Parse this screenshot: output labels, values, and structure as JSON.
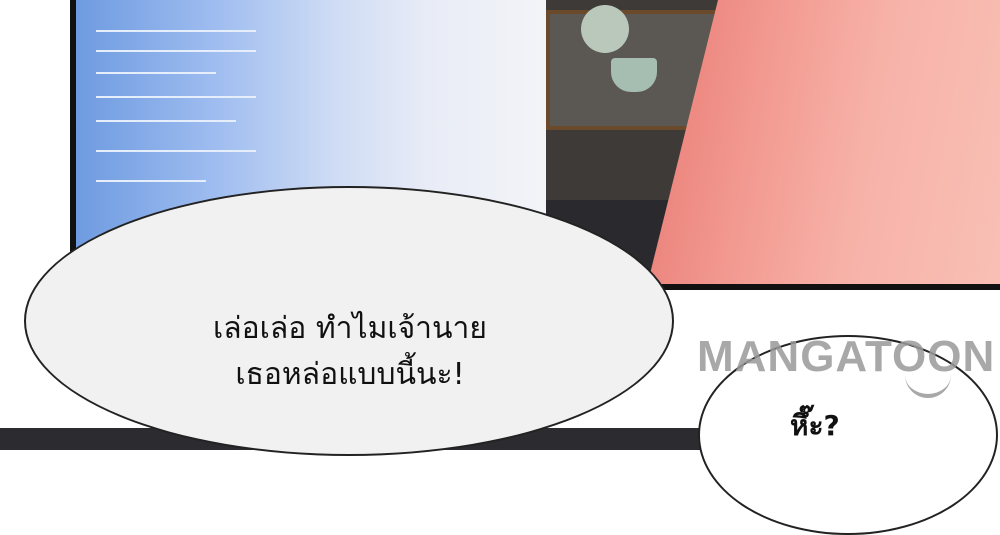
{
  "speech_bubbles": {
    "main": {
      "line1": "เล่อเล่อ ทำไมเจ้านาย",
      "line2": "เธอหล่อแบบนี้นะ!"
    },
    "small": {
      "text": "หึ๊ะ?"
    }
  },
  "watermark": {
    "text": "MANGATOON"
  }
}
